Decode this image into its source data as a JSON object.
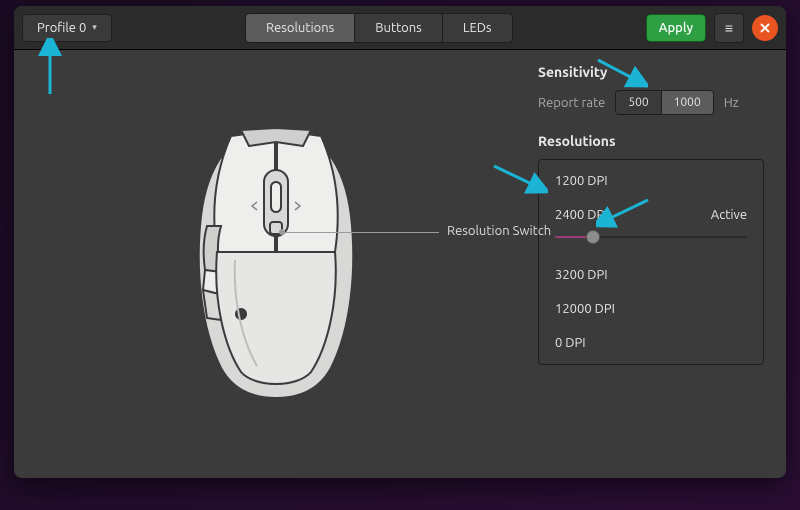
{
  "titlebar": {
    "profile_label": "Profile 0",
    "tabs": [
      {
        "label": "Resolutions"
      },
      {
        "label": "Buttons"
      },
      {
        "label": "LEDs"
      }
    ],
    "apply_label": "Apply"
  },
  "callout": {
    "label": "Resolution Switch"
  },
  "sensitivity": {
    "heading": "Sensitivity",
    "rate_label": "Report rate",
    "options": [
      "500",
      "1000"
    ],
    "selected": "1000",
    "unit": "Hz"
  },
  "resolutions": {
    "heading": "Resolutions",
    "active_label": "Active",
    "items": [
      {
        "label": "1200 DPI"
      },
      {
        "label": "2400 DPI",
        "active": true,
        "slider_pct": 20
      },
      {
        "label": "3200 DPI"
      },
      {
        "label": "12000 DPI"
      },
      {
        "label": "0 DPI"
      }
    ]
  },
  "colors": {
    "accent_green": "#2ea043",
    "close_orange": "#e95420",
    "slider_fill": "#9c3e75",
    "annotation_arrow": "#1bb4d4"
  }
}
